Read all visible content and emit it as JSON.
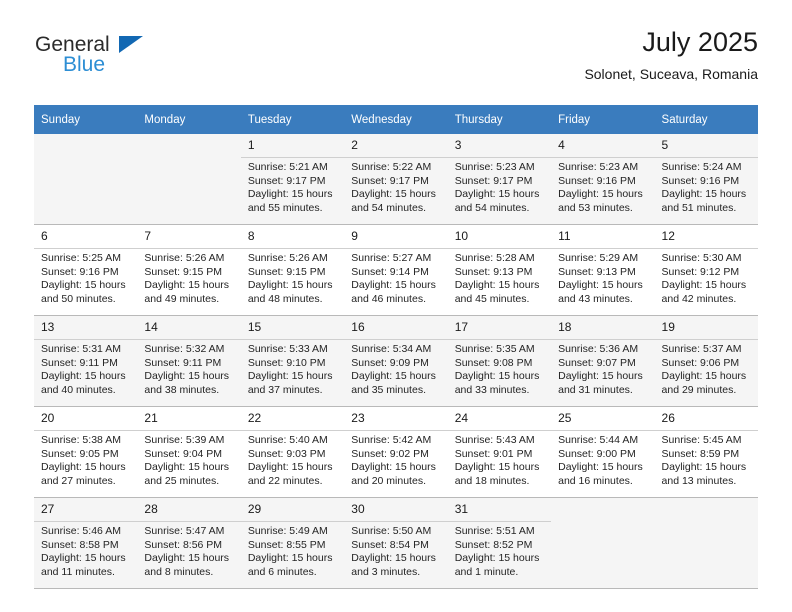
{
  "brand": {
    "name_top": "General",
    "name_bottom": "Blue",
    "triangle_color": "#1268b3",
    "blue_color": "#2d8ed4"
  },
  "header": {
    "title": "July 2025",
    "subtitle": "Solonet, Suceava, Romania"
  },
  "theme": {
    "header_row_bg": "#3a7cbe",
    "header_row_text": "#ffffff",
    "shaded_row_bg": "#f5f5f5",
    "cell_border": "#b9b9b9"
  },
  "weekdays": [
    "Sunday",
    "Monday",
    "Tuesday",
    "Wednesday",
    "Thursday",
    "Friday",
    "Saturday"
  ],
  "weeks": [
    {
      "shaded": true,
      "days": [
        {
          "num": "",
          "sunrise": "",
          "sunset": "",
          "daylight1": "",
          "daylight2": ""
        },
        {
          "num": "",
          "sunrise": "",
          "sunset": "",
          "daylight1": "",
          "daylight2": ""
        },
        {
          "num": "1",
          "sunrise": "Sunrise: 5:21 AM",
          "sunset": "Sunset: 9:17 PM",
          "daylight1": "Daylight: 15 hours",
          "daylight2": "and 55 minutes."
        },
        {
          "num": "2",
          "sunrise": "Sunrise: 5:22 AM",
          "sunset": "Sunset: 9:17 PM",
          "daylight1": "Daylight: 15 hours",
          "daylight2": "and 54 minutes."
        },
        {
          "num": "3",
          "sunrise": "Sunrise: 5:23 AM",
          "sunset": "Sunset: 9:17 PM",
          "daylight1": "Daylight: 15 hours",
          "daylight2": "and 54 minutes."
        },
        {
          "num": "4",
          "sunrise": "Sunrise: 5:23 AM",
          "sunset": "Sunset: 9:16 PM",
          "daylight1": "Daylight: 15 hours",
          "daylight2": "and 53 minutes."
        },
        {
          "num": "5",
          "sunrise": "Sunrise: 5:24 AM",
          "sunset": "Sunset: 9:16 PM",
          "daylight1": "Daylight: 15 hours",
          "daylight2": "and 51 minutes."
        }
      ]
    },
    {
      "shaded": false,
      "days": [
        {
          "num": "6",
          "sunrise": "Sunrise: 5:25 AM",
          "sunset": "Sunset: 9:16 PM",
          "daylight1": "Daylight: 15 hours",
          "daylight2": "and 50 minutes."
        },
        {
          "num": "7",
          "sunrise": "Sunrise: 5:26 AM",
          "sunset": "Sunset: 9:15 PM",
          "daylight1": "Daylight: 15 hours",
          "daylight2": "and 49 minutes."
        },
        {
          "num": "8",
          "sunrise": "Sunrise: 5:26 AM",
          "sunset": "Sunset: 9:15 PM",
          "daylight1": "Daylight: 15 hours",
          "daylight2": "and 48 minutes."
        },
        {
          "num": "9",
          "sunrise": "Sunrise: 5:27 AM",
          "sunset": "Sunset: 9:14 PM",
          "daylight1": "Daylight: 15 hours",
          "daylight2": "and 46 minutes."
        },
        {
          "num": "10",
          "sunrise": "Sunrise: 5:28 AM",
          "sunset": "Sunset: 9:13 PM",
          "daylight1": "Daylight: 15 hours",
          "daylight2": "and 45 minutes."
        },
        {
          "num": "11",
          "sunrise": "Sunrise: 5:29 AM",
          "sunset": "Sunset: 9:13 PM",
          "daylight1": "Daylight: 15 hours",
          "daylight2": "and 43 minutes."
        },
        {
          "num": "12",
          "sunrise": "Sunrise: 5:30 AM",
          "sunset": "Sunset: 9:12 PM",
          "daylight1": "Daylight: 15 hours",
          "daylight2": "and 42 minutes."
        }
      ]
    },
    {
      "shaded": true,
      "days": [
        {
          "num": "13",
          "sunrise": "Sunrise: 5:31 AM",
          "sunset": "Sunset: 9:11 PM",
          "daylight1": "Daylight: 15 hours",
          "daylight2": "and 40 minutes."
        },
        {
          "num": "14",
          "sunrise": "Sunrise: 5:32 AM",
          "sunset": "Sunset: 9:11 PM",
          "daylight1": "Daylight: 15 hours",
          "daylight2": "and 38 minutes."
        },
        {
          "num": "15",
          "sunrise": "Sunrise: 5:33 AM",
          "sunset": "Sunset: 9:10 PM",
          "daylight1": "Daylight: 15 hours",
          "daylight2": "and 37 minutes."
        },
        {
          "num": "16",
          "sunrise": "Sunrise: 5:34 AM",
          "sunset": "Sunset: 9:09 PM",
          "daylight1": "Daylight: 15 hours",
          "daylight2": "and 35 minutes."
        },
        {
          "num": "17",
          "sunrise": "Sunrise: 5:35 AM",
          "sunset": "Sunset: 9:08 PM",
          "daylight1": "Daylight: 15 hours",
          "daylight2": "and 33 minutes."
        },
        {
          "num": "18",
          "sunrise": "Sunrise: 5:36 AM",
          "sunset": "Sunset: 9:07 PM",
          "daylight1": "Daylight: 15 hours",
          "daylight2": "and 31 minutes."
        },
        {
          "num": "19",
          "sunrise": "Sunrise: 5:37 AM",
          "sunset": "Sunset: 9:06 PM",
          "daylight1": "Daylight: 15 hours",
          "daylight2": "and 29 minutes."
        }
      ]
    },
    {
      "shaded": false,
      "days": [
        {
          "num": "20",
          "sunrise": "Sunrise: 5:38 AM",
          "sunset": "Sunset: 9:05 PM",
          "daylight1": "Daylight: 15 hours",
          "daylight2": "and 27 minutes."
        },
        {
          "num": "21",
          "sunrise": "Sunrise: 5:39 AM",
          "sunset": "Sunset: 9:04 PM",
          "daylight1": "Daylight: 15 hours",
          "daylight2": "and 25 minutes."
        },
        {
          "num": "22",
          "sunrise": "Sunrise: 5:40 AM",
          "sunset": "Sunset: 9:03 PM",
          "daylight1": "Daylight: 15 hours",
          "daylight2": "and 22 minutes."
        },
        {
          "num": "23",
          "sunrise": "Sunrise: 5:42 AM",
          "sunset": "Sunset: 9:02 PM",
          "daylight1": "Daylight: 15 hours",
          "daylight2": "and 20 minutes."
        },
        {
          "num": "24",
          "sunrise": "Sunrise: 5:43 AM",
          "sunset": "Sunset: 9:01 PM",
          "daylight1": "Daylight: 15 hours",
          "daylight2": "and 18 minutes."
        },
        {
          "num": "25",
          "sunrise": "Sunrise: 5:44 AM",
          "sunset": "Sunset: 9:00 PM",
          "daylight1": "Daylight: 15 hours",
          "daylight2": "and 16 minutes."
        },
        {
          "num": "26",
          "sunrise": "Sunrise: 5:45 AM",
          "sunset": "Sunset: 8:59 PM",
          "daylight1": "Daylight: 15 hours",
          "daylight2": "and 13 minutes."
        }
      ]
    },
    {
      "shaded": true,
      "days": [
        {
          "num": "27",
          "sunrise": "Sunrise: 5:46 AM",
          "sunset": "Sunset: 8:58 PM",
          "daylight1": "Daylight: 15 hours",
          "daylight2": "and 11 minutes."
        },
        {
          "num": "28",
          "sunrise": "Sunrise: 5:47 AM",
          "sunset": "Sunset: 8:56 PM",
          "daylight1": "Daylight: 15 hours",
          "daylight2": "and 8 minutes."
        },
        {
          "num": "29",
          "sunrise": "Sunrise: 5:49 AM",
          "sunset": "Sunset: 8:55 PM",
          "daylight1": "Daylight: 15 hours",
          "daylight2": "and 6 minutes."
        },
        {
          "num": "30",
          "sunrise": "Sunrise: 5:50 AM",
          "sunset": "Sunset: 8:54 PM",
          "daylight1": "Daylight: 15 hours",
          "daylight2": "and 3 minutes."
        },
        {
          "num": "31",
          "sunrise": "Sunrise: 5:51 AM",
          "sunset": "Sunset: 8:52 PM",
          "daylight1": "Daylight: 15 hours",
          "daylight2": "and 1 minute."
        },
        {
          "num": "",
          "sunrise": "",
          "sunset": "",
          "daylight1": "",
          "daylight2": ""
        },
        {
          "num": "",
          "sunrise": "",
          "sunset": "",
          "daylight1": "",
          "daylight2": ""
        }
      ]
    }
  ]
}
